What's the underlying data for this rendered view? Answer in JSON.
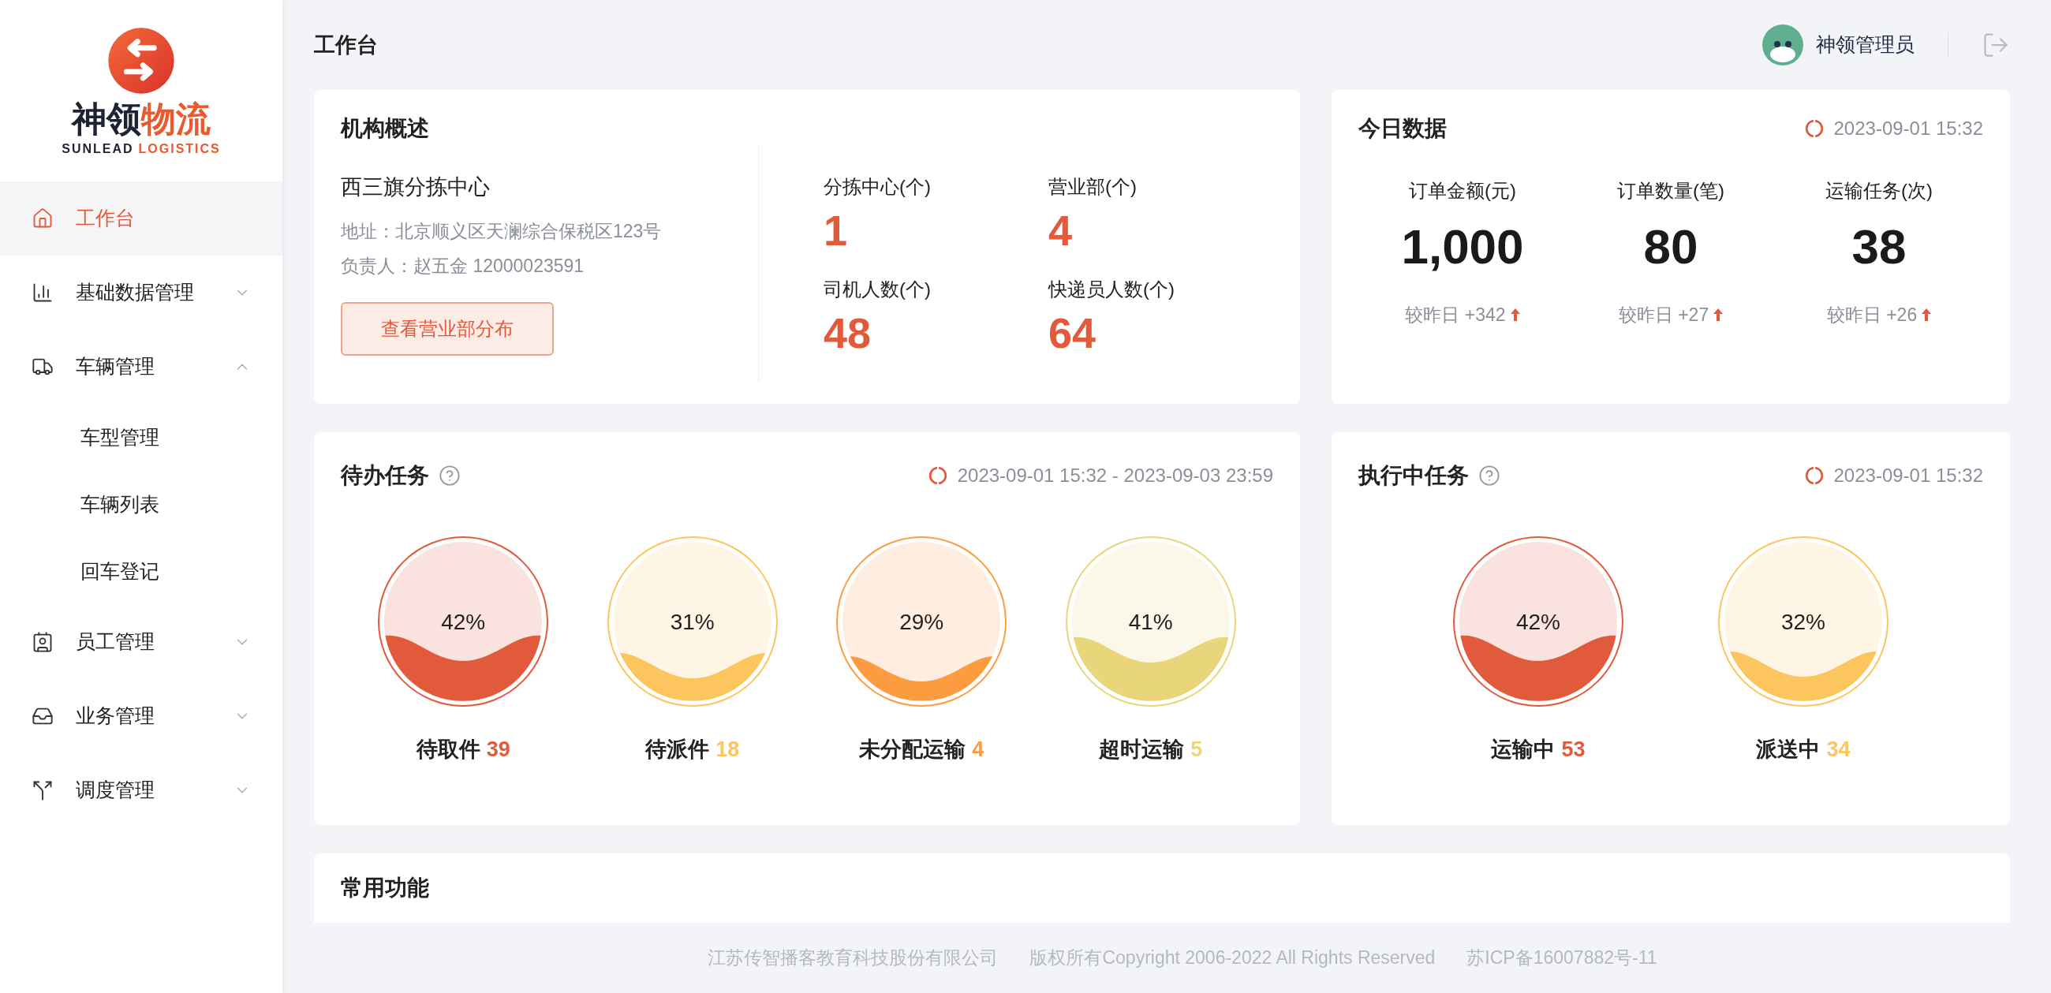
{
  "sidebar": {
    "brand": [
      "神领",
      "物流"
    ],
    "tagline": [
      "SUNLEAD",
      "LOGISTICS"
    ],
    "items": [
      {
        "label": "工作台",
        "selected": true
      },
      {
        "label": "基础数据管理",
        "selected": false,
        "expanded": false
      },
      {
        "label": "车辆管理",
        "selected": false,
        "expanded": true,
        "children": [
          {
            "label": "车型管理",
            "selected": false
          },
          {
            "label": "车辆列表",
            "selected": false
          },
          {
            "label": "回车登记",
            "selected": false
          }
        ]
      },
      {
        "label": "员工管理",
        "selected": false,
        "expanded": false
      },
      {
        "label": "业务管理",
        "selected": false,
        "expanded": false
      },
      {
        "label": "调度管理",
        "selected": false,
        "expanded": false
      }
    ]
  },
  "header": {
    "title": "工作台",
    "user": "神领管理员"
  },
  "overview": {
    "title": "机构概述",
    "center": "西三旗分拣中心",
    "address": "地址：北京顺义区天澜综合保税区123号",
    "manager": "负责人：赵五金 12000023591",
    "button": "查看营业部分布",
    "stats": [
      {
        "label": "分拣中心(个)",
        "value": "1"
      },
      {
        "label": "营业部(个)",
        "value": "4"
      },
      {
        "label": "司机人数(个)",
        "value": "48"
      },
      {
        "label": "快递员人数(个)",
        "value": "64"
      }
    ]
  },
  "today": {
    "title": "今日数据",
    "time": "2023-09-01 15:32",
    "metrics": [
      {
        "label": "订单金额(元)",
        "value": "1,000",
        "compare": "较昨日 +342"
      },
      {
        "label": "订单数量(笔)",
        "value": "80",
        "compare": "较昨日 +27"
      },
      {
        "label": "运输任务(次)",
        "value": "38",
        "compare": "较昨日 +26"
      }
    ]
  },
  "pending": {
    "title": "待办任务",
    "time": "2023-09-01 15:32 - 2023-09-03 23:59",
    "gauges": [
      {
        "percent": "42%",
        "level": 0.42,
        "label": "待取件",
        "count": "39",
        "color": "#e15a3c"
      },
      {
        "percent": "31%",
        "level": 0.31,
        "label": "待派件",
        "count": "18",
        "color": "#fdc55d"
      },
      {
        "percent": "29%",
        "level": 0.29,
        "label": "未分配运输",
        "count": "4",
        "color": "#fd9b40"
      },
      {
        "percent": "41%",
        "level": 0.41,
        "label": "超时运输",
        "count": "5",
        "color": "#e9d67a"
      }
    ]
  },
  "executing": {
    "title": "执行中任务",
    "time": "2023-09-01 15:32",
    "gauges": [
      {
        "percent": "42%",
        "level": 0.42,
        "label": "运输中",
        "count": "53",
        "color": "#e15a3c"
      },
      {
        "percent": "32%",
        "level": 0.32,
        "label": "派送中",
        "count": "34",
        "color": "#fdc55d"
      }
    ]
  },
  "common": {
    "title": "常用功能"
  },
  "footer": [
    "江苏传智播客教育科技股份有限公司",
    "版权所有Copyright 2006-2022 All Rights Reserved",
    "苏ICP备16007882号-11"
  ]
}
